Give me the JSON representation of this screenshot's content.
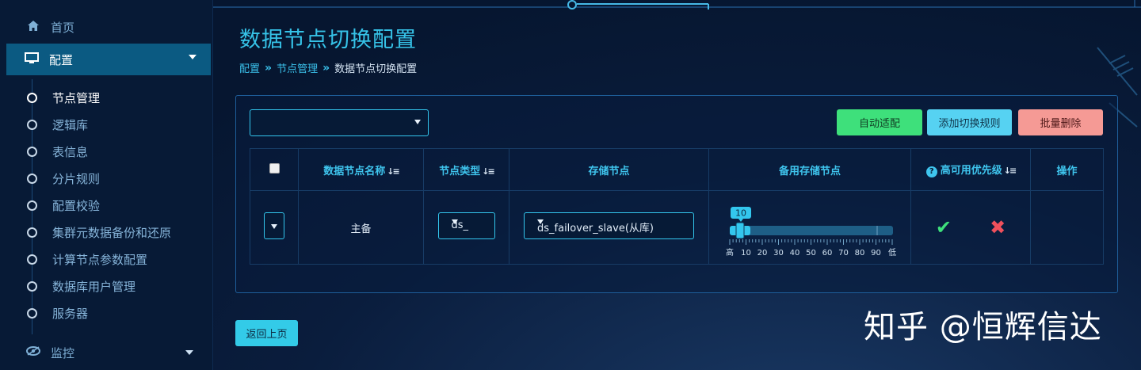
{
  "sidebar": {
    "home_label": "首页",
    "config_label": "配置",
    "monitor_label": "监控",
    "sub_items": [
      {
        "label": "节点管理",
        "active": true
      },
      {
        "label": "逻辑库"
      },
      {
        "label": "表信息"
      },
      {
        "label": "分片规则"
      },
      {
        "label": "配置校验"
      },
      {
        "label": "集群元数据备份和还原"
      },
      {
        "label": "计算节点参数配置"
      },
      {
        "label": "数据库用户管理"
      },
      {
        "label": "服务器"
      }
    ]
  },
  "page": {
    "title": "数据节点切换配置",
    "breadcrumb": [
      "配置",
      "节点管理",
      "数据节点切换配置"
    ]
  },
  "toolbar": {
    "filter_value": "",
    "auto_label": "自动适配",
    "add_label": "添加切换规则",
    "delete_label": "批量删除"
  },
  "table": {
    "headers": [
      "数据节点名称",
      "节点类型",
      "存储节点",
      "备用存储节点",
      "高可用优先级",
      "操作"
    ],
    "row": {
      "node_type": "主备",
      "storage_node": "ds_",
      "standby_node": "ds_failover_slave(从库)",
      "priority_value": "10",
      "scale_labels": [
        "高",
        "10",
        "20",
        "30",
        "40",
        "50",
        "60",
        "70",
        "80",
        "90",
        "低"
      ]
    }
  },
  "back_label": "返回上页",
  "watermark": "知乎 @恒辉信达",
  "colors": {
    "accent": "#36c3e8",
    "green": "#3ee07b",
    "cyan": "#56d2f2",
    "pink": "#f59a95"
  },
  "icons": [
    "home-icon",
    "monitor-icon",
    "eye-icon",
    "question-icon",
    "sort-icon",
    "check-icon",
    "close-icon"
  ]
}
